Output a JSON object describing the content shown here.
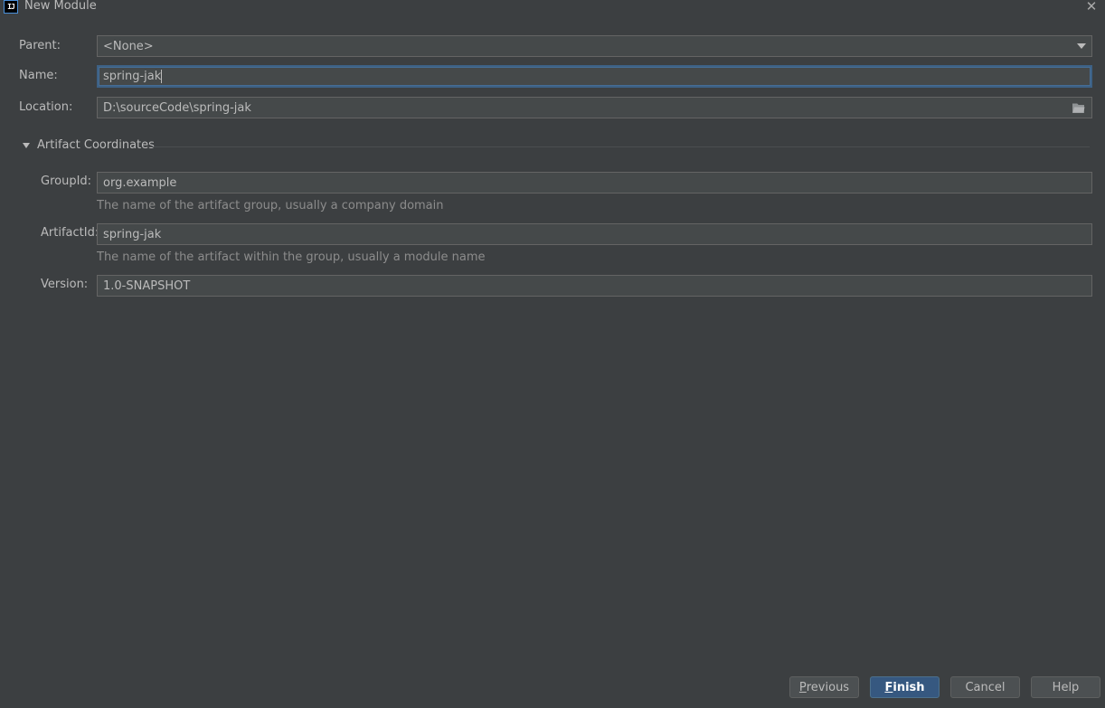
{
  "window": {
    "title": "New Module",
    "app_icon_glyph": "IJ",
    "close_glyph": "✕"
  },
  "form": {
    "parent": {
      "label": "Parent:",
      "value": "<None>"
    },
    "name": {
      "label": "Name:",
      "value": "spring-jak"
    },
    "location": {
      "label": "Location:",
      "value": "D:\\sourceCode\\spring-jak"
    }
  },
  "artifact": {
    "section_title": "Artifact Coordinates",
    "group_id": {
      "label": "GroupId:",
      "value": "org.example",
      "hint": "The name of the artifact group, usually a company domain"
    },
    "artifact_id": {
      "label": "ArtifactId:",
      "value": "spring-jak",
      "hint": "The name of the artifact within the group, usually a module name"
    },
    "version": {
      "label": "Version:",
      "value": "1.0-SNAPSHOT"
    }
  },
  "buttons": {
    "previous": {
      "mnemonic": "P",
      "rest": "revious"
    },
    "finish": {
      "mnemonic": "F",
      "rest": "inish"
    },
    "cancel": "Cancel",
    "help": "Help"
  },
  "colors": {
    "background": "#3c3f41",
    "field_background": "#45494a",
    "focus_border": "#3d6185",
    "primary_button": "#365880"
  },
  "icons": {
    "parent_dropdown": "chevron-down-icon",
    "location_browse": "folder-icon",
    "section_toggle": "triangle-down-icon"
  }
}
